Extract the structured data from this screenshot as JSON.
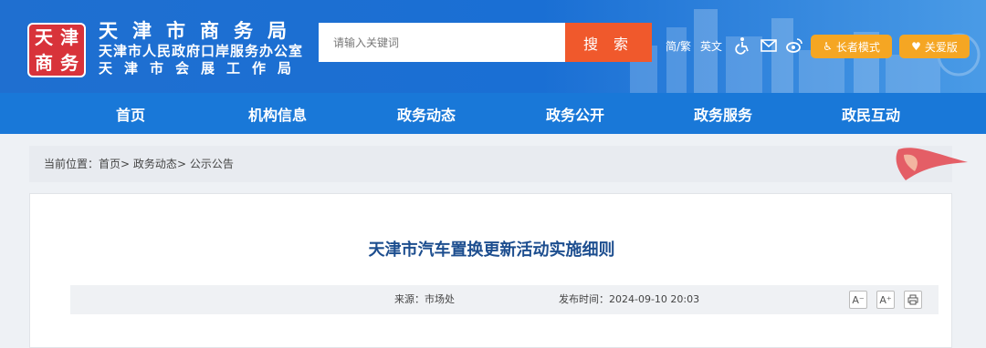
{
  "header": {
    "seal_text": [
      "天",
      "津",
      "商",
      "务"
    ],
    "title_main": "天津市商务局",
    "title_sub": "天津市人民政府口岸服务办公室",
    "title_sub2": "天津市会展工作局"
  },
  "search": {
    "placeholder": "请输入关键词",
    "button_label": "搜 索"
  },
  "tools": {
    "traditional": "简/繁",
    "english": "英文",
    "accessibility_icon": "wheelchair-icon",
    "mail_icon": "mail-icon",
    "weibo_icon": "weibo-icon",
    "elder_mode": "长者模式",
    "care_mode": "关爱版"
  },
  "nav": {
    "items": [
      {
        "label": "首页"
      },
      {
        "label": "机构信息"
      },
      {
        "label": "政务动态"
      },
      {
        "label": "政务公开"
      },
      {
        "label": "政务服务"
      },
      {
        "label": "政民互动"
      }
    ]
  },
  "breadcrumb": {
    "prefix": "当前位置：",
    "items": [
      "首页",
      "政务动态",
      "公示公告"
    ],
    "separator": ">"
  },
  "article": {
    "title": "天津市汽车置换更新活动实施细则",
    "source_label": "来源：市场处",
    "date_label": "发布时间：2024-09-10 20:03",
    "font_smaller": "A⁻",
    "font_larger": "A⁺",
    "print_icon": "print-icon"
  },
  "colors": {
    "header_blue": "#1f6fd0",
    "nav_blue": "#1978d8",
    "search_orange": "#f0592c",
    "pill_orange": "#f5a623",
    "title_blue": "#1d4e8f"
  }
}
